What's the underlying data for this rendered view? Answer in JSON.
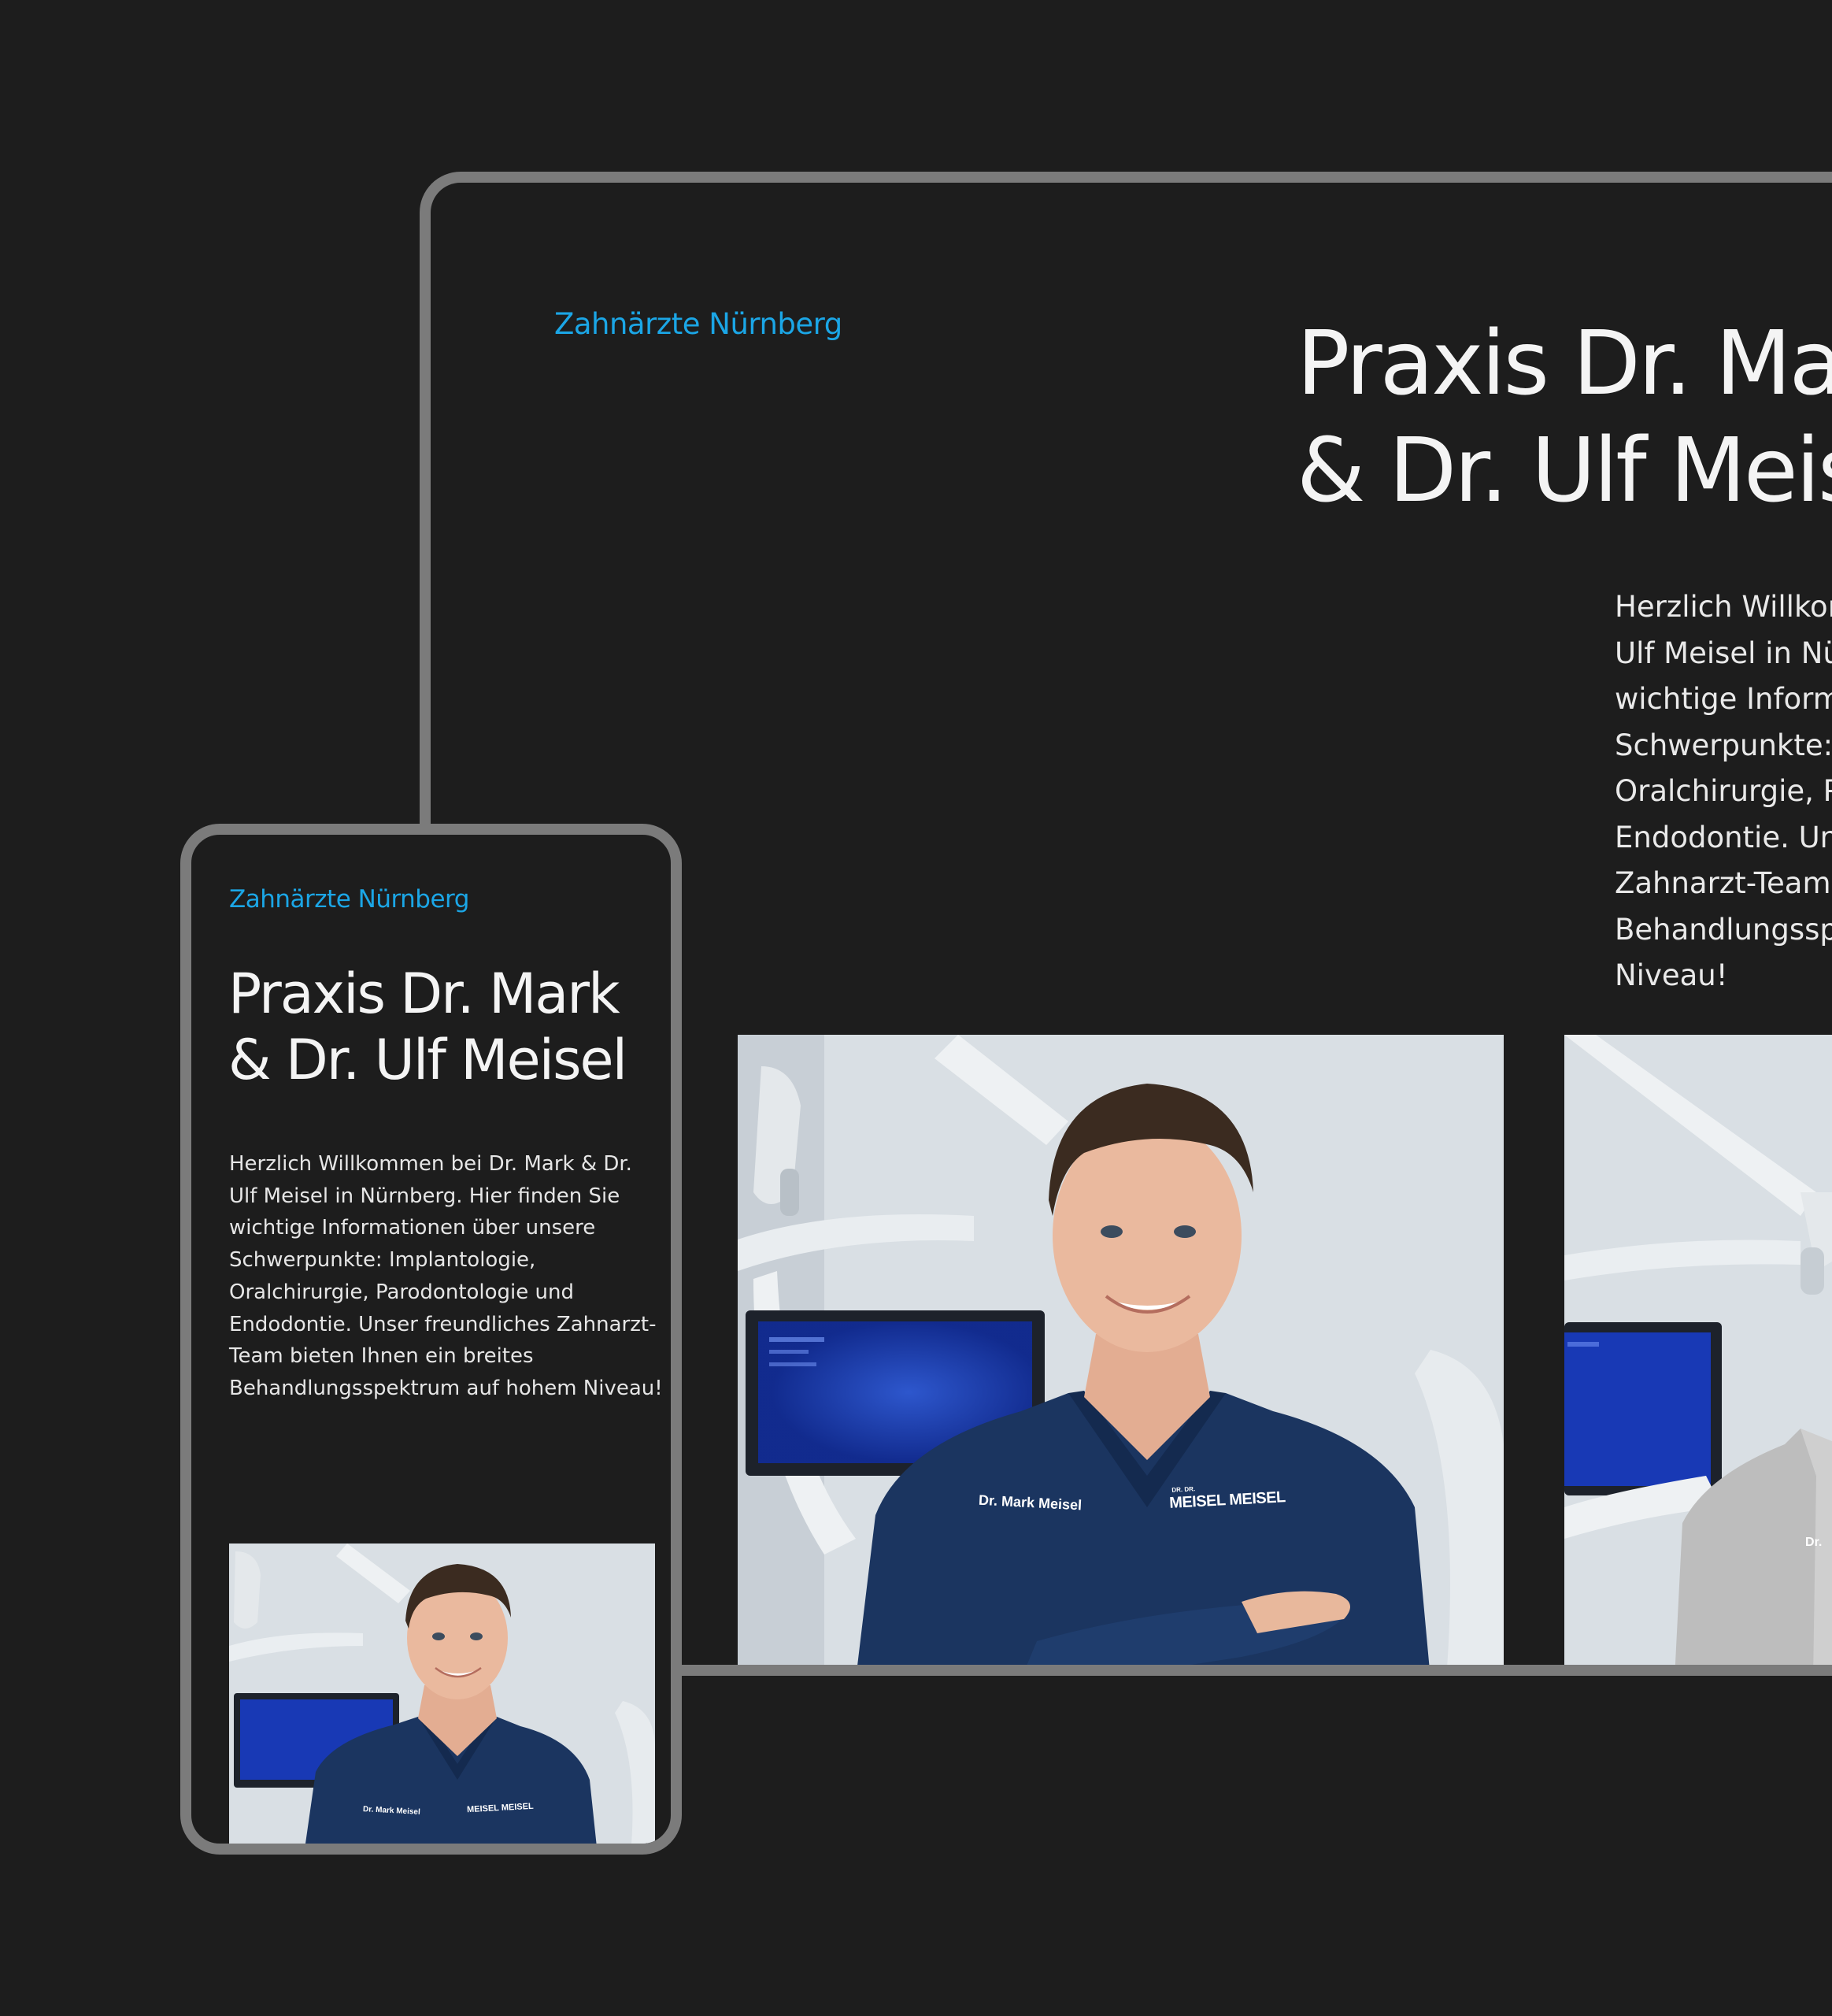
{
  "desktop": {
    "brand": "Zahnärzte Nürnberg",
    "title_line1": "Praxis Dr. Mark",
    "title_line2": "& Dr. Ulf Meisel",
    "intro": "Herzlich Willkommen bei Dr. Mark & Dr. Ulf Meisel in Nürnberg. Hier finden Sie wichtige Informationen über unsere Schwerpunkte: Implantologie, Oralchirurgie, Parodontologie und Endodontie. Unser freundliches Zahnarzt-Team bieten Ihnen ein breites Behandlungsspektrum auf hohem Niveau!",
    "photos": [
      {
        "shirt_name": "Dr. Mark Meisel",
        "shirt_logo": "MEISEL MEISEL",
        "shirt_logo_small": "DR. DR."
      },
      {
        "shirt_name": "Dr."
      }
    ]
  },
  "mobile": {
    "brand": "Zahnärzte Nürnberg",
    "title_line1": "Praxis Dr. Mark",
    "title_line2": "& Dr. Ulf Meisel",
    "intro": "Herzlich Willkommen bei Dr. Mark & Dr. Ulf Meisel in Nürnberg. Hier finden Sie wichtige Informationen über unsere Schwerpunkte: Implantologie, Oralchirurgie, Parodontologie und Endodontie. Unser freundliches Zahnarzt-Team bieten Ihnen ein breites Behandlungsspektrum auf hohem Niveau!",
    "photo": {
      "shirt_name": "Dr. Mark Meisel",
      "shirt_logo": "MEISEL MEISEL"
    }
  },
  "colors": {
    "background": "#1d1d1d",
    "frame": "#7b7b7b",
    "accent": "#1ba6e6",
    "scrubs": "#1b3560"
  }
}
